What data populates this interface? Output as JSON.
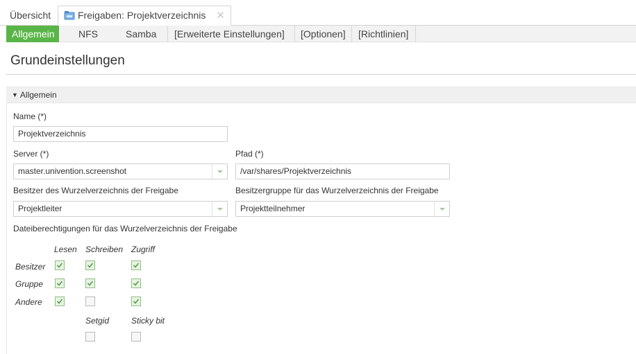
{
  "top_tabs": {
    "overview": "Übersicht",
    "active": "Freigaben: Projektverzeichnis"
  },
  "sub_tabs": [
    "Allgemein",
    "NFS",
    "Samba",
    "[Erweiterte Einstellungen]",
    "[Optionen]",
    "[Richtlinien]"
  ],
  "page_title": "Grundeinstellungen",
  "section": {
    "title": "Allgemein"
  },
  "form": {
    "name_label": "Name (*)",
    "name_value": "Projektverzeichnis",
    "server_label": "Server (*)",
    "server_value": "master.univention.screenshot",
    "path_label": "Pfad (*)",
    "path_value": "/var/shares/Projektverzeichnis",
    "owner_label": "Besitzer des Wurzelverzeichnis der Freigabe",
    "owner_value": "Projektleiter",
    "group_label": "Besitzergruppe für das Wurzelverzeichnis der Freigabe",
    "group_value": "Projektteilnehmer",
    "perm_label": "Dateiberechtigungen für das Wurzelverzeichnis der Freigabe"
  },
  "permissions": {
    "columns": [
      "Lesen",
      "Schreiben",
      "Zugriff"
    ],
    "rows": [
      {
        "label": "Besitzer",
        "checked": [
          true,
          true,
          true
        ]
      },
      {
        "label": "Gruppe",
        "checked": [
          true,
          true,
          true
        ]
      },
      {
        "label": "Andere",
        "checked": [
          true,
          false,
          true
        ]
      }
    ],
    "extra_columns": [
      "Setgid",
      "Sticky bit"
    ],
    "extra_checked": [
      false,
      false
    ]
  },
  "colors": {
    "accent": "#5ab548"
  }
}
